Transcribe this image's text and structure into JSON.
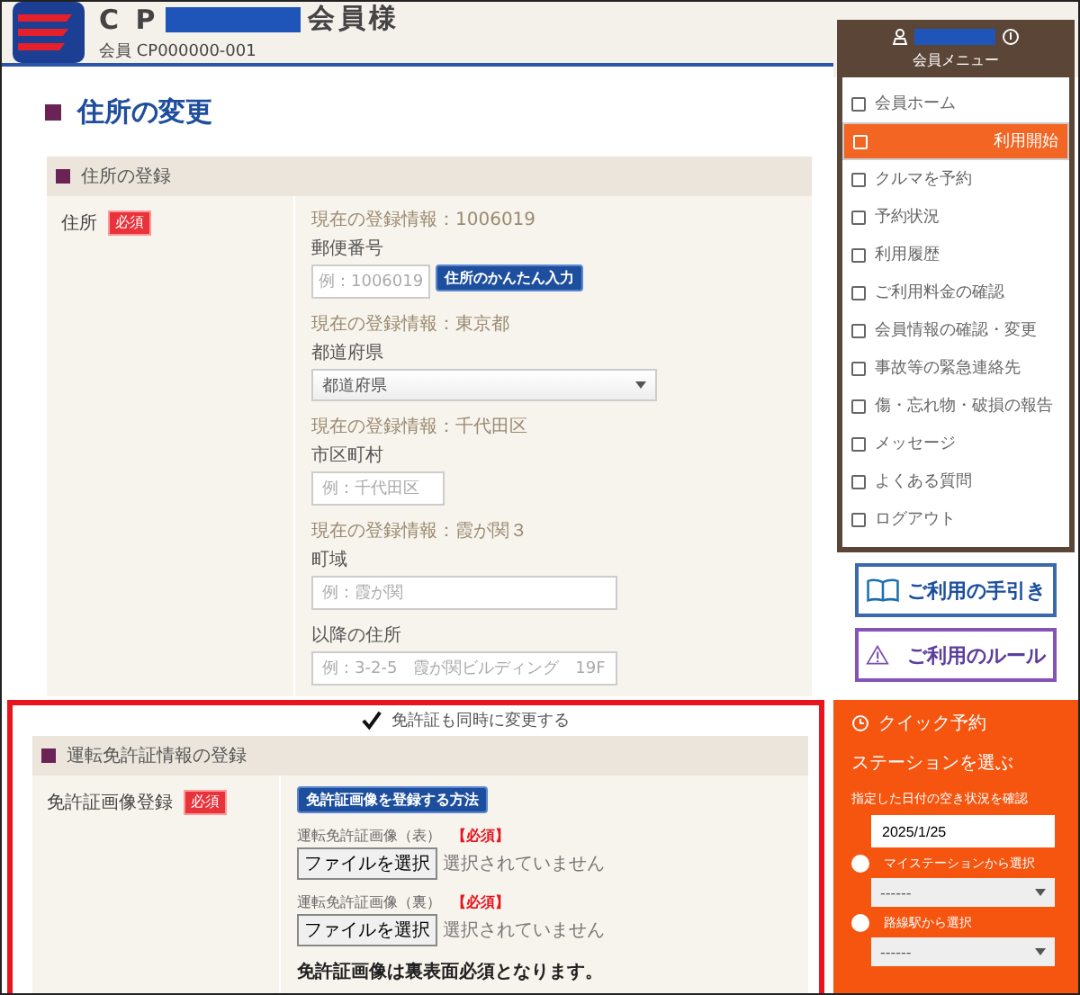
{
  "header": {
    "title_prefix": "C P",
    "title_suffix": "会員様",
    "member_id": "会員 CP000000-001"
  },
  "page_title": "住所の変更",
  "address_section": {
    "title": "住所の登録",
    "label": "住所",
    "required_badge": "必須",
    "fields": [
      {
        "kind": "postal",
        "current": "現在の登録情報：1006019",
        "label": "郵便番号",
        "placeholder": "例：1006019",
        "button": "住所のかんたん入力"
      },
      {
        "kind": "select",
        "current": "現在の登録情報：東京都",
        "label": "都道府県",
        "value": "都道府県"
      },
      {
        "kind": "short",
        "current": "現在の登録情報：千代田区",
        "label": "市区町村",
        "placeholder": "例：千代田区"
      },
      {
        "kind": "wide",
        "current": "現在の登録情報：霞が関３",
        "label": "町域",
        "placeholder": "例：霞が関"
      },
      {
        "kind": "wide",
        "label": "以降の住所",
        "placeholder": "例：3-2-5　霞が関ビルディング　19F"
      }
    ]
  },
  "license_toggle": {
    "label": "免許証も同時に変更する",
    "checked": true
  },
  "license_section": {
    "title": "運転免許証情報の登録",
    "label": "免許証画像登録",
    "required_badge": "必須",
    "howto_button": "免許証画像を登録する方法",
    "uploads": [
      {
        "label": "運転免許証画像（表）",
        "required": "【必須】",
        "button": "ファイルを選択",
        "status": "選択されていません"
      },
      {
        "label": "運転免許証画像（裏）",
        "required": "【必須】",
        "button": "ファイルを選択",
        "status": "選択されていません"
      }
    ],
    "note": "免許証画像は裏表面必須となります。"
  },
  "menu": {
    "title": "会員メニュー",
    "items": [
      {
        "label": "会員ホーム",
        "selected": false
      },
      {
        "label": "利用開始",
        "selected": true
      },
      {
        "label": "クルマを予約",
        "selected": false
      },
      {
        "label": "予約状況",
        "selected": false
      },
      {
        "label": "利用履歴",
        "selected": false
      },
      {
        "label": "ご利用料金の確認",
        "selected": false
      },
      {
        "label": "会員情報の確認・変更",
        "selected": false
      },
      {
        "label": "事故等の緊急連絡先",
        "selected": false
      },
      {
        "label": "傷・忘れ物・破損の報告",
        "selected": false
      },
      {
        "label": "メッセージ",
        "selected": false
      },
      {
        "label": "よくある質問",
        "selected": false
      },
      {
        "label": "ログアウト",
        "selected": false
      }
    ]
  },
  "guide_links": [
    {
      "kind": "guide",
      "label": "ご利用の手引き"
    },
    {
      "kind": "rules",
      "label": "ご利用のルール"
    }
  ],
  "quick": {
    "title": "クイック予約",
    "subtitle": "ステーションを選ぶ",
    "date_label": "指定した日付の空き状況を確認",
    "date": "2025/1/25",
    "options": [
      {
        "label": "マイステーションから選択",
        "selected": false,
        "value": "------"
      },
      {
        "label": "路線駅から選択",
        "selected": false,
        "value": "------"
      }
    ]
  }
}
